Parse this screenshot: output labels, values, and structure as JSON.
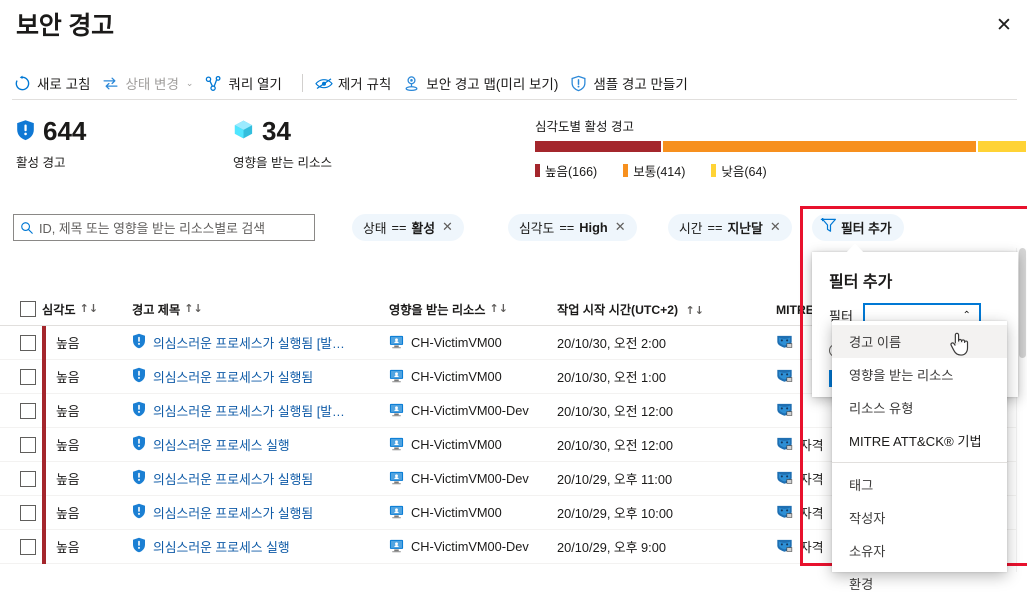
{
  "page": {
    "title": "보안 경고",
    "close_label": "✕"
  },
  "toolbar": {
    "items": [
      {
        "label": "새로 고침",
        "icon": "refresh-icon",
        "disabled": false
      },
      {
        "label": "상태 변경",
        "icon": "change-status-icon",
        "disabled": true,
        "chevron": "⌄"
      },
      {
        "label": "쿼리 열기",
        "icon": "open-query-icon",
        "disabled": false
      },
      {
        "label": "제거 규칙",
        "icon": "suppression-rule-icon",
        "disabled": false
      },
      {
        "label": "보안 경고 맵(미리 보기)",
        "icon": "alert-map-icon",
        "disabled": false
      },
      {
        "label": "샘플 경고 만들기",
        "icon": "create-sample-alert-icon",
        "disabled": false
      }
    ]
  },
  "summary": {
    "active_alerts": {
      "value": "644",
      "caption": "활성 경고",
      "icon": "shield-alert-icon"
    },
    "affected_resources": {
      "value": "34",
      "caption": "영향을 받는 리소스",
      "icon": "resource-cube-icon"
    }
  },
  "severity_chart": {
    "title": "심각도별 활성 경고",
    "total": 644,
    "segments": [
      {
        "label": "높음",
        "count": 166,
        "legend": "높음(166)",
        "color": "#a4262c",
        "pct": 25.8
      },
      {
        "label": "보통",
        "count": 414,
        "legend": "보통(414)",
        "color": "#f7901e",
        "pct": 64.3
      },
      {
        "label": "낮음",
        "count": 64,
        "legend": "낮음(64)",
        "color": "#ffd335",
        "pct": 9.9
      }
    ]
  },
  "search": {
    "placeholder": "ID, 제목 또는 영향을 받는 리소스별로 검색",
    "value": "",
    "icon": "search-icon"
  },
  "filter_chips": [
    {
      "field": "상태",
      "op": "==",
      "value": "활성",
      "remove": "✕"
    },
    {
      "field": "심각도",
      "op": "==",
      "value": "High",
      "remove": "✕"
    },
    {
      "field": "시간",
      "op": "==",
      "value": "지난달",
      "remove": "✕"
    }
  ],
  "add_filter_chip": {
    "label": "필터 추가",
    "icon": "add-filter-icon"
  },
  "table": {
    "columns": [
      {
        "key": "severity",
        "label": "심각도",
        "sort": "↑↓"
      },
      {
        "key": "title",
        "label": "경고 제목",
        "sort": "↑↓"
      },
      {
        "key": "resource",
        "label": "영향을 받는 리소스",
        "sort": "↑↓"
      },
      {
        "key": "time",
        "label": "작업 시작 시간(UTC+2)",
        "sort": "↑↓"
      },
      {
        "key": "mitre",
        "label": "MITRE ATT&CK® 기법",
        "sort": "↑↓"
      }
    ],
    "rows": [
      {
        "severity": "높음",
        "title": "의심스러운 프로세스가 실행됨 [발…",
        "resource": "CH-VictimVM00",
        "time": "20/10/30, 오전 2:00",
        "mitre": ""
      },
      {
        "severity": "높음",
        "title": "의심스러운 프로세스가 실행됨",
        "resource": "CH-VictimVM00",
        "time": "20/10/30, 오전 1:00",
        "mitre": ""
      },
      {
        "severity": "높음",
        "title": "의심스러운 프로세스가 실행됨 [발…",
        "resource": "CH-VictimVM00-Dev",
        "time": "20/10/30, 오전 12:00",
        "mitre": ""
      },
      {
        "severity": "높음",
        "title": "의심스러운 프로세스 실행",
        "resource": "CH-VictimVM00",
        "time": "20/10/30, 오전 12:00",
        "mitre": "자격"
      },
      {
        "severity": "높음",
        "title": "의심스러운 프로세스가 실행됨",
        "resource": "CH-VictimVM00-Dev",
        "time": "20/10/29, 오후 11:00",
        "mitre": "자격"
      },
      {
        "severity": "높음",
        "title": "의심스러운 프로세스가 실행됨",
        "resource": "CH-VictimVM00",
        "time": "20/10/29, 오후 10:00",
        "mitre": "자격"
      },
      {
        "severity": "높음",
        "title": "의심스러운 프로세스 실행",
        "resource": "CH-VictimVM00-Dev",
        "time": "20/10/29, 오후 9:00",
        "mitre": "자격"
      }
    ]
  },
  "callout": {
    "heading": "필터 추가",
    "filter_label": "필터",
    "combo_value": "",
    "combo_arrow": "⌃"
  },
  "dropdown": {
    "options": [
      {
        "label": "경고 이름",
        "highlighted": true
      },
      {
        "label": "영향을 받는 리소스",
        "highlighted": false
      },
      {
        "label": "리소스 유형",
        "highlighted": false
      },
      {
        "label": "MITRE ATT&CK® 기법",
        "highlighted": false
      },
      {
        "label": "태그",
        "highlighted": false,
        "after_separator": true
      },
      {
        "label": "작성자",
        "highlighted": false
      },
      {
        "label": "소유자",
        "highlighted": false
      },
      {
        "label": "환경",
        "highlighted": false
      }
    ]
  },
  "colors": {
    "accent": "#0078d4",
    "link": "#0f5ba7",
    "high": "#a4262c",
    "medium": "#f7901e",
    "low": "#ffd335",
    "highlight_box": "#e8112d"
  }
}
